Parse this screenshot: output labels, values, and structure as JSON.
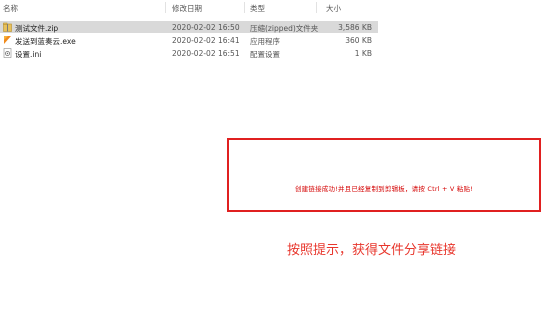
{
  "columns": {
    "name": "名称",
    "date": "修改日期",
    "type": "类型",
    "size": "大小"
  },
  "files": [
    {
      "name": "测试文件.zip",
      "date": "2020-02-02 16:50",
      "type": "压缩(zipped)文件夹",
      "size": "3,586 KB",
      "icon": "zip-folder-icon",
      "selected": true
    },
    {
      "name": "发送到蓝奏云.exe",
      "date": "2020-02-02 16:41",
      "type": "应用程序",
      "size": "360 KB",
      "icon": "exe-app-icon",
      "selected": false
    },
    {
      "name": "设置.ini",
      "date": "2020-02-02 16:51",
      "type": "配置设置",
      "size": "1 KB",
      "icon": "ini-settings-icon",
      "selected": false
    }
  ],
  "dialog": {
    "message": "创建链接成功!并且已经复制到剪辑板，请按 Ctrl + V 粘贴!"
  },
  "annotation": {
    "text": "按照提示，获得文件分享链接"
  },
  "colors": {
    "selection": "#d9d9d9",
    "alert_red": "#e02020",
    "note_red": "#e8362c"
  }
}
